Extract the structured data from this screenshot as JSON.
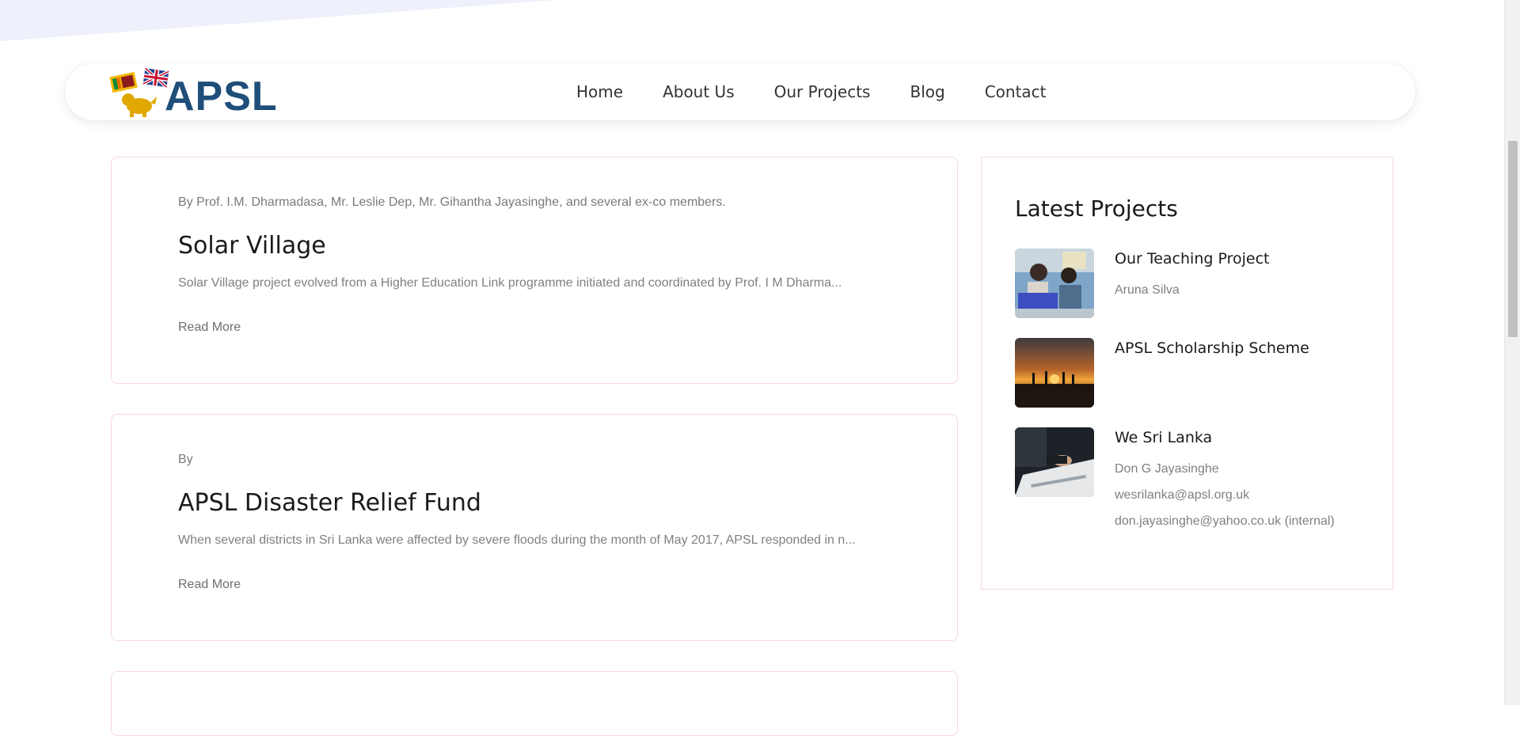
{
  "brand": {
    "logo_text": "APSL"
  },
  "nav": {
    "items": [
      {
        "label": "Home"
      },
      {
        "label": "About Us"
      },
      {
        "label": "Our Projects"
      },
      {
        "label": "Blog"
      },
      {
        "label": "Contact"
      }
    ]
  },
  "projects": [
    {
      "by": "By Prof. I.M. Dharmadasa, Mr. Leslie Dep, Mr. Gihantha Jayasinghe, and several ex-co members.",
      "title": "Solar Village",
      "excerpt": "Solar Village project evolved from a Higher Education Link programme initiated and coordinated by Prof. I M Dharma...",
      "read_more": "Read More"
    },
    {
      "by": "By",
      "title": "APSL Disaster Relief Fund",
      "excerpt": "When several districts in Sri Lanka were affected by severe floods during the month of May 2017, APSL responded in n...",
      "read_more": "Read More"
    }
  ],
  "sidebar": {
    "heading": "Latest Projects",
    "items": [
      {
        "title": "Our Teaching Project",
        "meta": [
          "Aruna Silva"
        ]
      },
      {
        "title": "APSL Scholarship Scheme",
        "meta": []
      },
      {
        "title": "We Sri Lanka",
        "meta": [
          "Don G Jayasinghe",
          "wesrilanka@apsl.org.uk",
          "don.jayasinghe@yahoo.co.uk (internal)"
        ]
      }
    ]
  },
  "colors": {
    "brand_blue": "#1f4e7a",
    "card_border": "#f8d9de",
    "header_bg_shape": "#eef0fb"
  }
}
